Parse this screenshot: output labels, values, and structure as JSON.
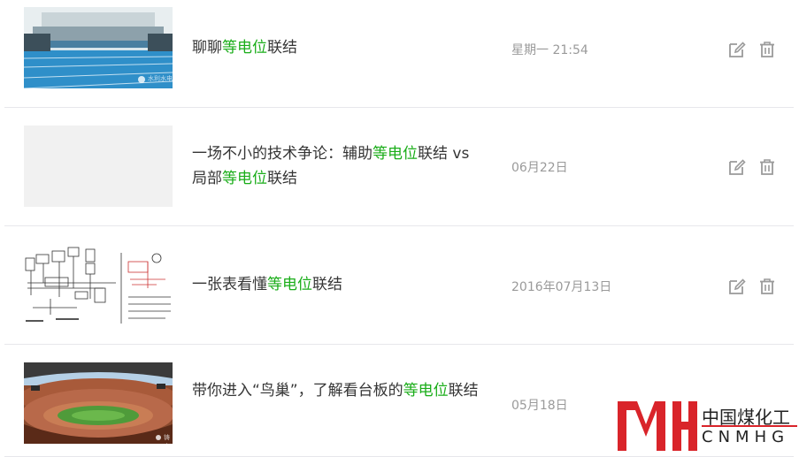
{
  "articles": [
    {
      "title_parts": [
        "聊聊",
        "等电位",
        "联结"
      ],
      "date": "星期一 21:54",
      "thumbnail": "swimming-pool-photo",
      "watermark": "水利水电"
    },
    {
      "title_parts": [
        "一场不小的技术争论：辅助",
        "等电位",
        "联结 vs 局部",
        "等电位",
        "联结"
      ],
      "date": "06月22日",
      "thumbnail": "placeholder-grey"
    },
    {
      "title_parts": [
        "一张表看懂",
        "等电位",
        "联结"
      ],
      "date": "2016年07月13日",
      "thumbnail": "wiring-diagram"
    },
    {
      "title_parts": [
        "带你进入“鸟巢”，了解看台板的",
        "等电位",
        "联结"
      ],
      "date": "05月18日",
      "thumbnail": "stadium-photo",
      "watermark": "铸安"
    }
  ],
  "actions": {
    "edit_icon": "edit-icon",
    "delete_icon": "trash-icon"
  },
  "logo": {
    "name": "中国煤化工",
    "sub": "CNMHG",
    "brand_color": "#d9242a"
  },
  "colors": {
    "highlight": "#1aad19",
    "title": "#353535",
    "date": "#9a9a9a",
    "icon": "#9a9a9a",
    "divider": "#e7e7eb"
  }
}
